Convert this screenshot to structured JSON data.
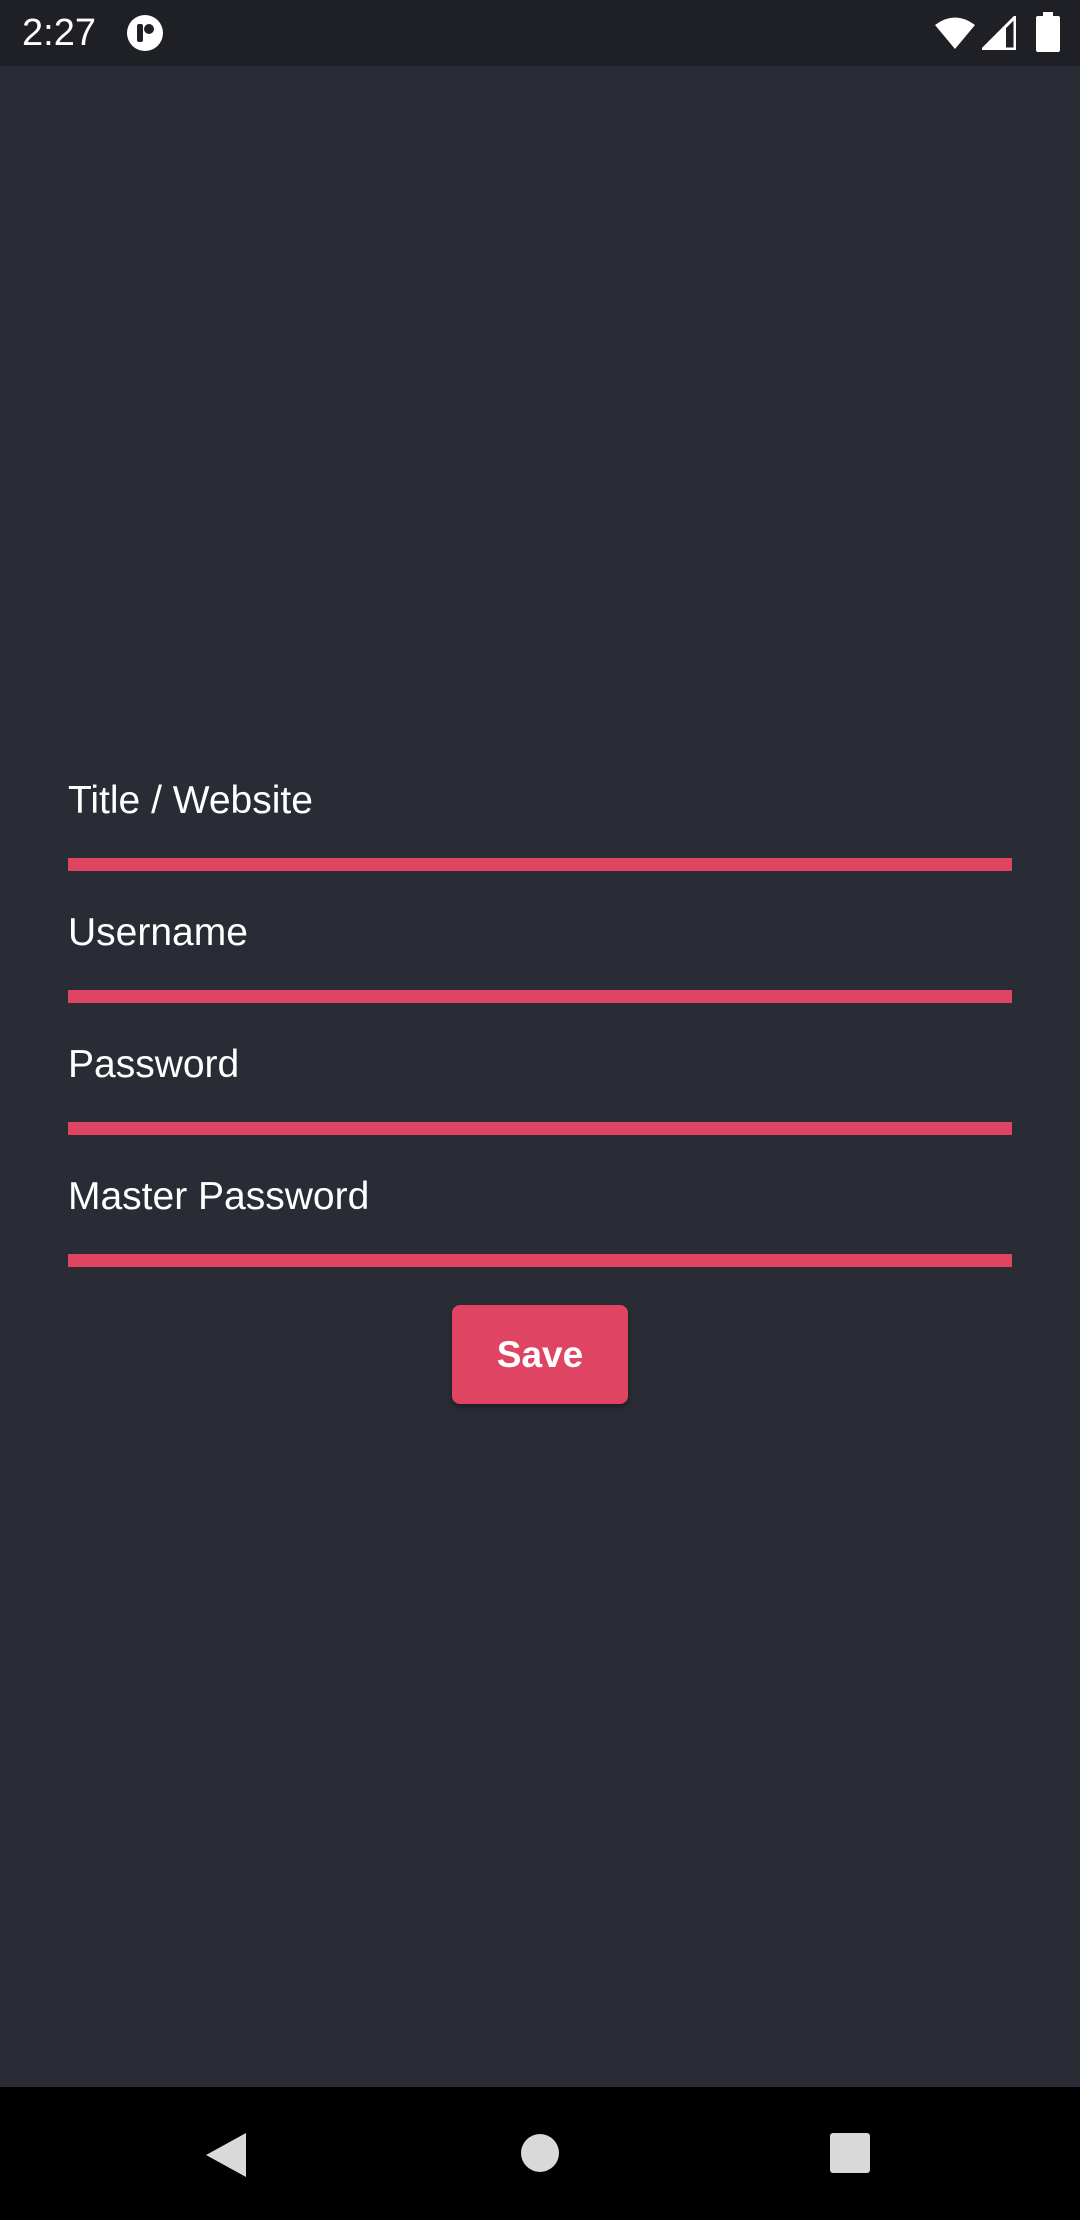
{
  "status_bar": {
    "time": "2:27",
    "icons": [
      "notification-app-icon",
      "wifi-icon",
      "cellular-signal-icon",
      "battery-icon"
    ]
  },
  "form": {
    "fields": [
      {
        "label": "Title / Website",
        "value": ""
      },
      {
        "label": "Username",
        "value": ""
      },
      {
        "label": "Password",
        "value": ""
      },
      {
        "label": "Master Password",
        "value": ""
      }
    ],
    "save_label": "Save"
  },
  "nav_bar": {
    "icons": [
      "back-icon",
      "home-icon",
      "recents-icon"
    ]
  },
  "colors": {
    "background": "#2a2c35",
    "accent": "#e04463",
    "status_bar": "#1f2026",
    "nav_bar": "#000000",
    "text": "#ffffff"
  }
}
